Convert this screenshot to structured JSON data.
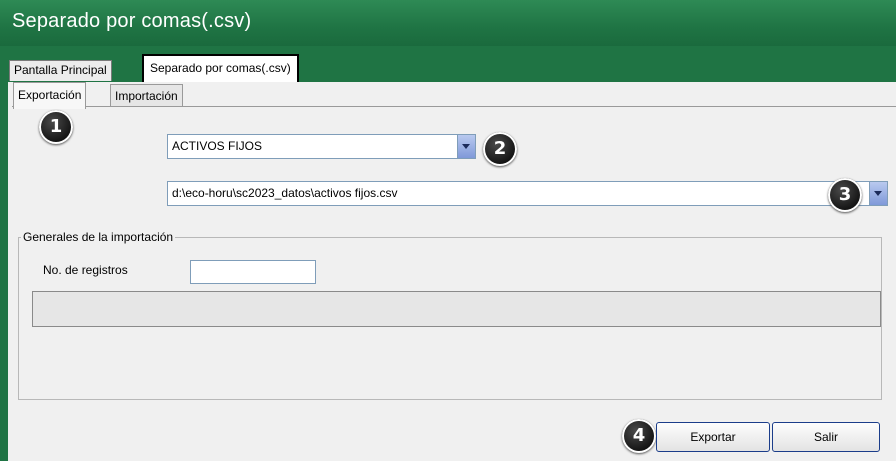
{
  "window": {
    "title": "Separado por comas(.csv)"
  },
  "top_tabs": [
    {
      "label": "Pantalla Principal"
    },
    {
      "label": "Separado por comas(.csv)"
    }
  ],
  "sub_tabs": [
    {
      "label": "Exportación"
    },
    {
      "label": "Importación"
    }
  ],
  "badges": [
    "1",
    "2",
    "3",
    "4"
  ],
  "table_combo": {
    "value": "ACTIVOS FIJOS"
  },
  "file_combo": {
    "value": "d:\\eco-horu\\sc2023_datos\\activos fijos.csv"
  },
  "group": {
    "legend": "Generales de la importación",
    "records_label": "No. de registros",
    "records_value": "",
    "progress": 0
  },
  "buttons": {
    "export": "Exportar",
    "exit": "Salir"
  },
  "colors": {
    "title_bar": "#1f7444",
    "button_border": "#1b3d8a"
  }
}
